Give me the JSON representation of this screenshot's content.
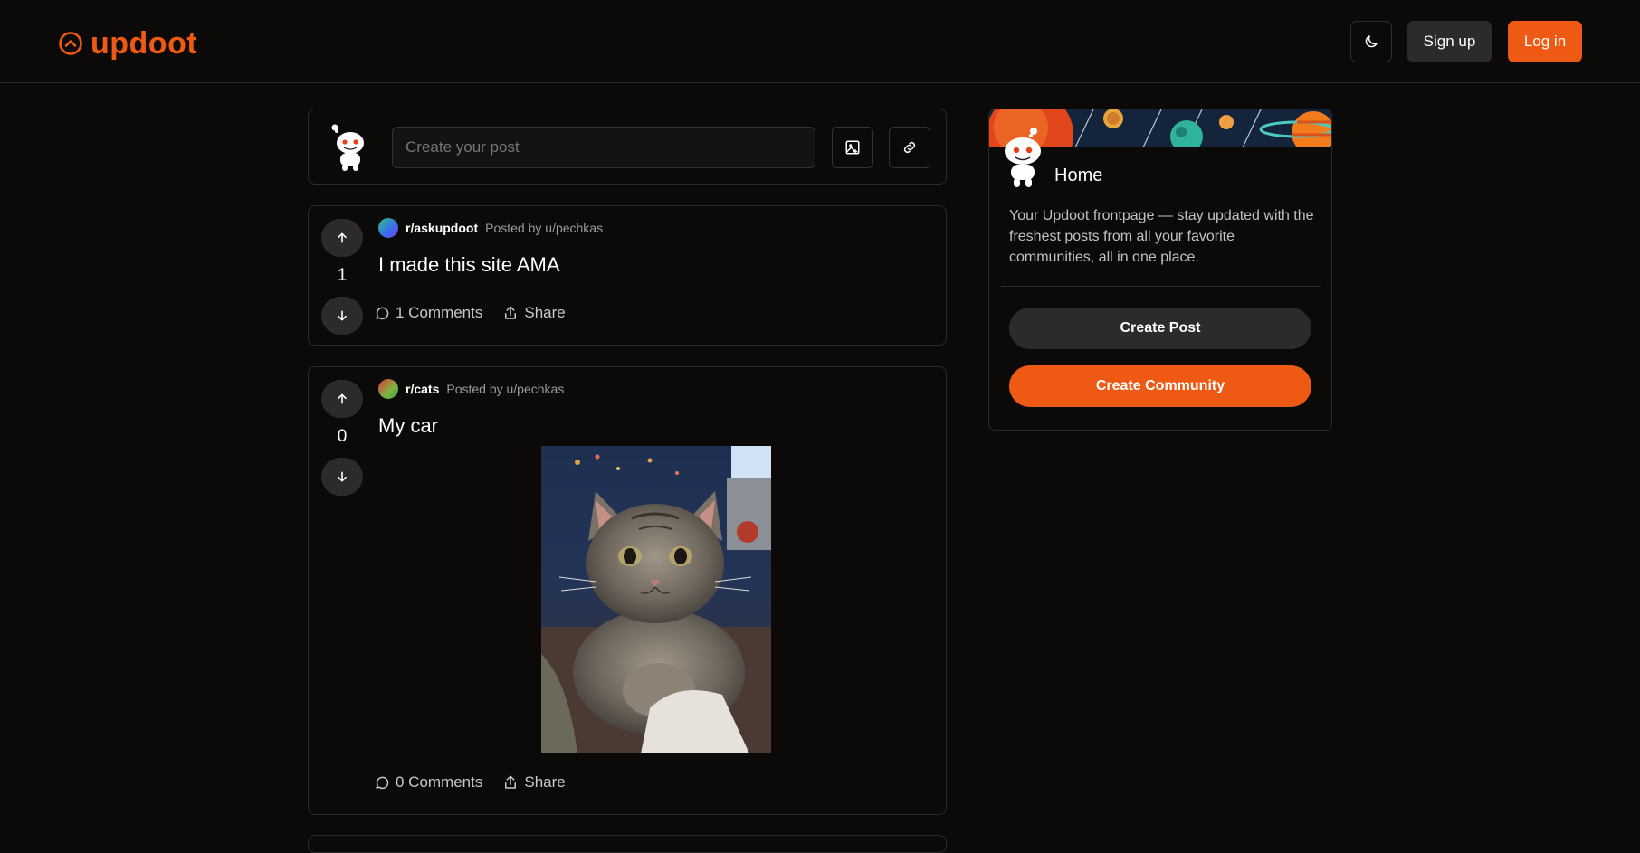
{
  "header": {
    "logo_text": "updoot",
    "signup_label": "Sign up",
    "login_label": "Log in",
    "accent_color": "#ee5a13"
  },
  "composer": {
    "placeholder": "Create your post",
    "image_icon": "image-icon",
    "link_icon": "link-icon"
  },
  "posts": [
    {
      "subreddit": "r/askupdoot",
      "posted_by": "Posted by u/pechkas",
      "title": "I made this site AMA",
      "score": "1",
      "comments_label": "1 Comments",
      "share_label": "Share"
    },
    {
      "subreddit": "r/cats",
      "posted_by": "Posted by u/pechkas",
      "title": "My car",
      "score": "0",
      "comments_label": "0 Comments",
      "share_label": "Share"
    }
  ],
  "sidebar": {
    "title": "Home",
    "description": "Your Updoot frontpage — stay updated with the freshest posts from all your favorite communities, all in one place.",
    "create_post_label": "Create Post",
    "create_community_label": "Create Community"
  }
}
